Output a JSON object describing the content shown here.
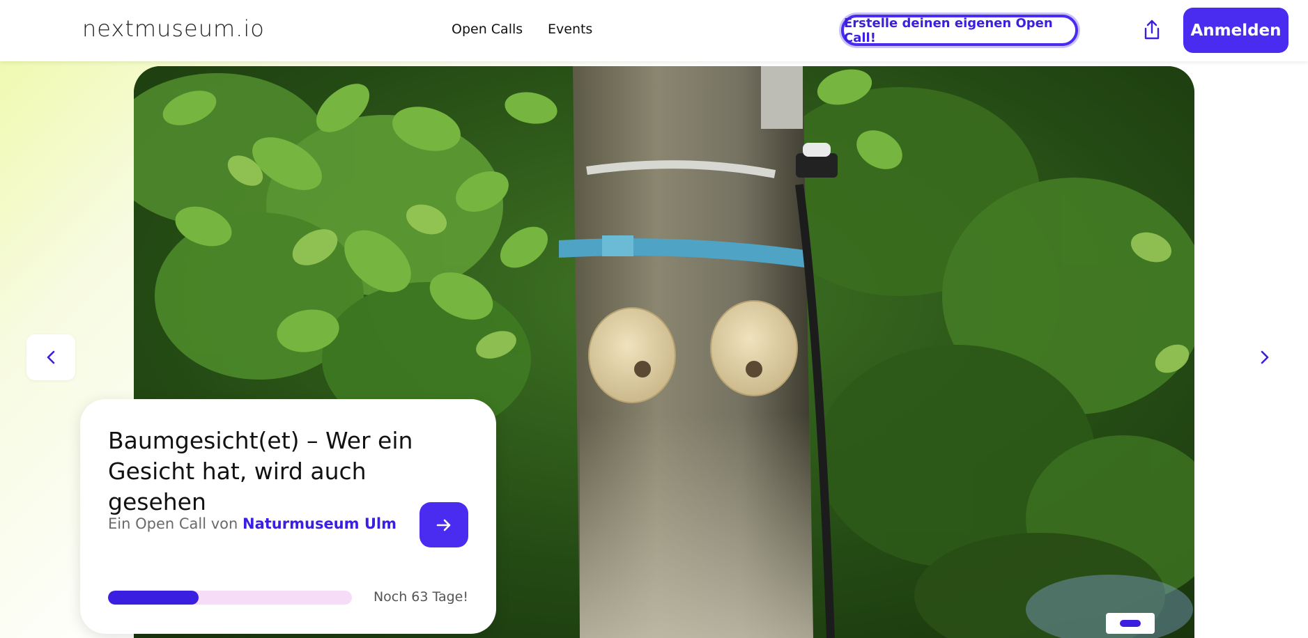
{
  "header": {
    "logo": "nextmuseum.io",
    "nav": [
      {
        "label": "Open Calls"
      },
      {
        "label": "Events"
      }
    ],
    "create_open_call_label": "Erstelle deinen eigenen Open Call!",
    "login_label": "Anmelden"
  },
  "hero": {
    "image_description": "tree-with-wooden-eyes",
    "prev_icon": "chevron-left-icon",
    "next_icon": "chevron-right-icon"
  },
  "card": {
    "title": "Baumgesicht(et) – Wer ein Gesicht hat, wird auch gesehen",
    "subtitle_prefix": "Ein Open Call von",
    "organization": "Naturmuseum Ulm",
    "progress_fraction": 0.37,
    "days_left": "Noch 63 Tage!"
  },
  "colors": {
    "accent": "#4a2cf0",
    "progress_track": "#f6dcf7"
  }
}
